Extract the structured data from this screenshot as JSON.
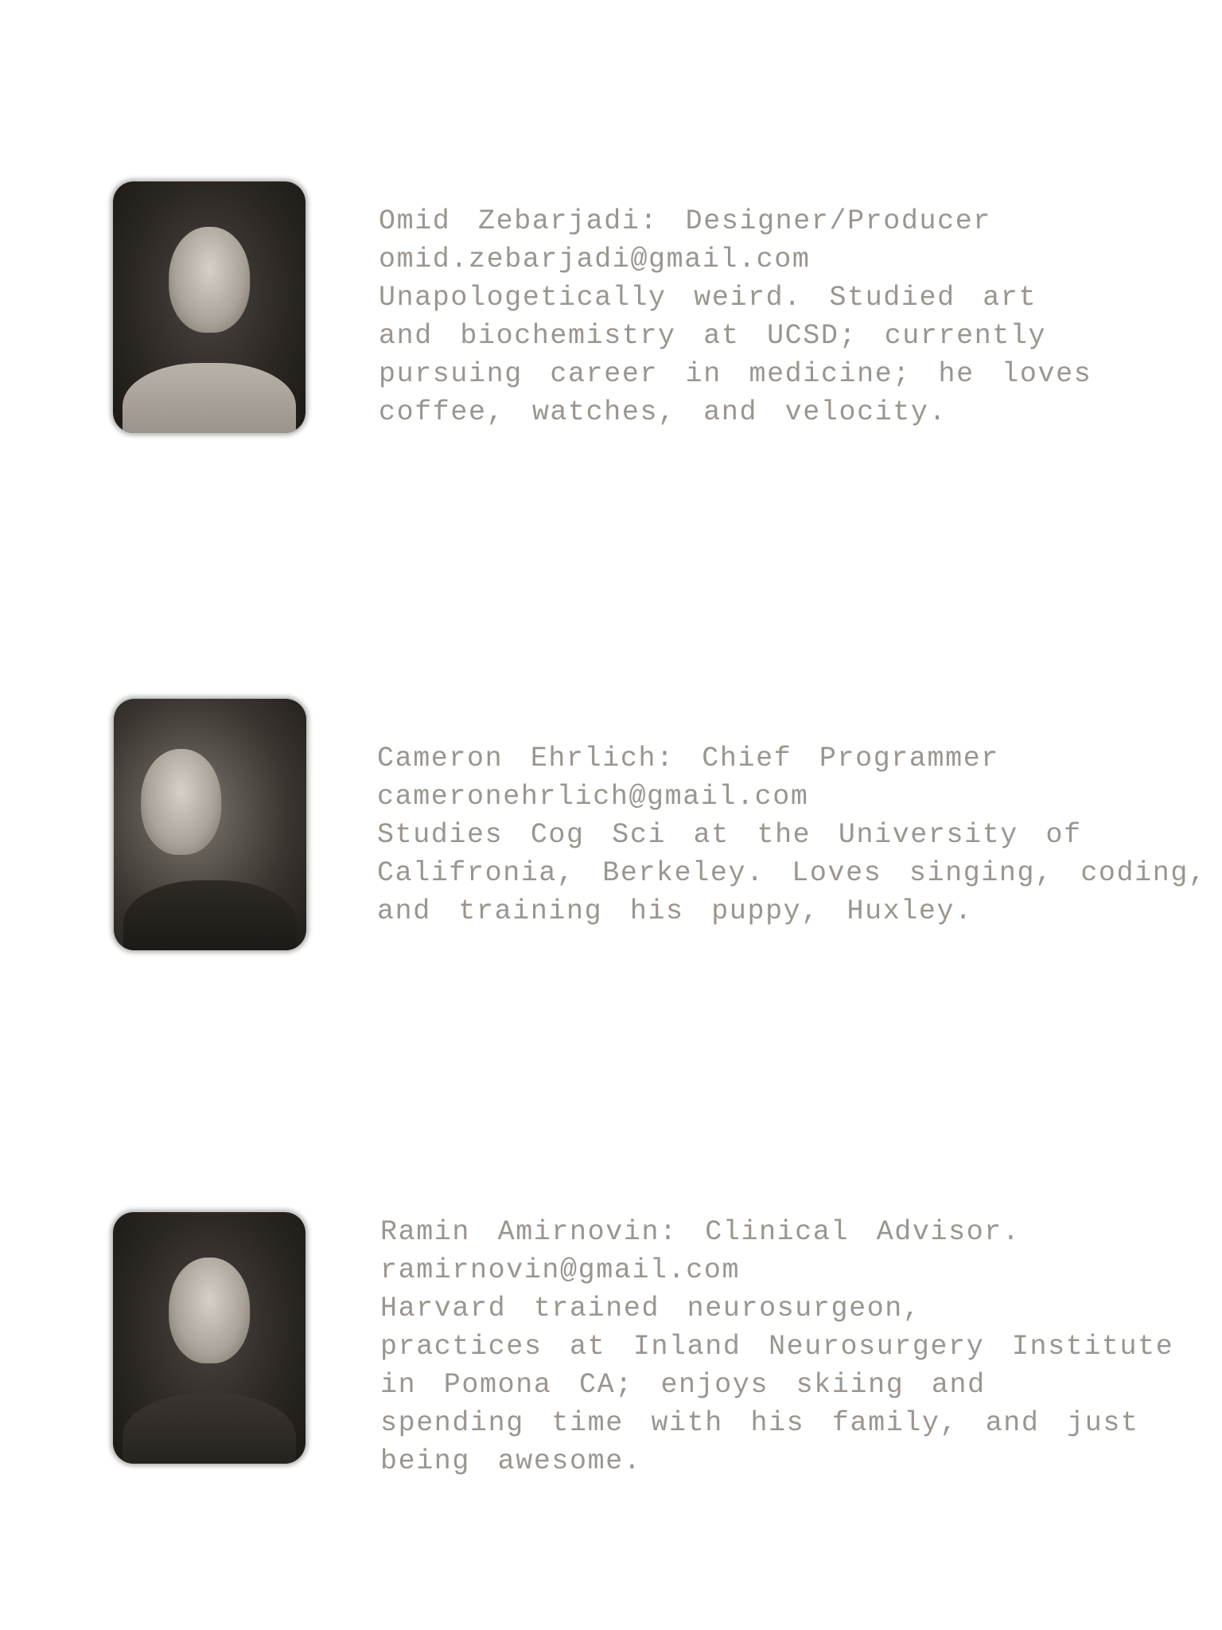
{
  "team": [
    {
      "photo": "portrait-photo",
      "title": "Omid Zebarjadi: Designer/Producer",
      "email": "omid.zebarjadi@gmail.com",
      "bio_lines": [
        "Unapologetically weird. Studied art",
        "and biochemistry at UCSD; currently",
        "pursuing career in medicine; he loves",
        "coffee, watches, and velocity."
      ]
    },
    {
      "photo": "portrait-photo",
      "title": "Cameron Ehrlich: Chief Programmer",
      "email": "cameronehrlich@gmail.com",
      "bio_lines": [
        "Studies Cog Sci at the University of",
        "Califronia, Berkeley. Loves singing, coding,",
        "and training his puppy, Huxley."
      ]
    },
    {
      "photo": "portrait-photo",
      "title": "Ramin Amirnovin: Clinical Advisor.",
      "email": "ramirnovin@gmail.com",
      "bio_lines": [
        "Harvard trained neurosurgeon,",
        "practices at Inland Neurosurgery Institute",
        "in Pomona CA; enjoys skiing and",
        "spending time with his family, and just",
        "being awesome."
      ]
    }
  ],
  "colors": {
    "text": "#9b958f",
    "background": "#ffffff"
  }
}
